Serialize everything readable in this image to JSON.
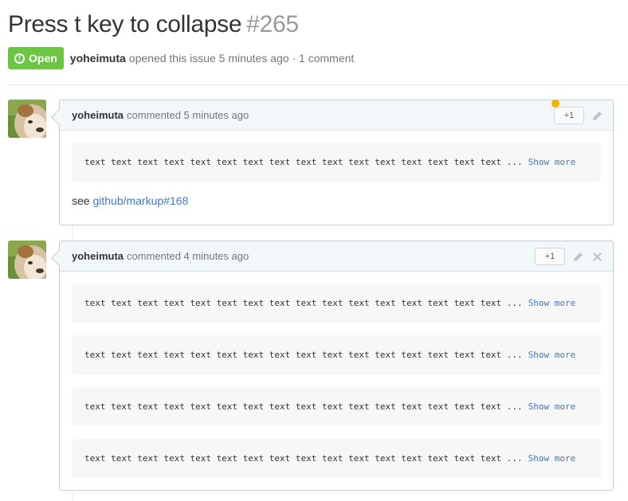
{
  "issue": {
    "title": "Press t key to collapse",
    "number": "#265",
    "state_label": "Open",
    "state_icon": "!",
    "state_color": "#6cc644",
    "author": "yoheimuta",
    "meta_text": "opened this issue 5 minutes ago · 1 comment"
  },
  "comments": [
    {
      "author": "yoheimuta",
      "time_text": "commented 5 minutes ago",
      "plus_one": "+1",
      "code_blocks": [
        {
          "text": "text text text text text text text text text text text text text text text text ...",
          "more": "Show more"
        }
      ],
      "see_label": "see",
      "link_text": "github/markup#168"
    },
    {
      "author": "yoheimuta",
      "time_text": "commented 4 minutes ago",
      "plus_one": "+1",
      "code_blocks": [
        {
          "text": "text text text text text text text text text text text text text text text text ...",
          "more": "Show more"
        },
        {
          "text": "text text text text text text text text text text text text text text text text ...",
          "more": "Show more"
        },
        {
          "text": "text text text text text text text text text text text text text text text text ...",
          "more": "Show more"
        },
        {
          "text": "text text text text text text text text text text text text text text text text ...",
          "more": "Show more"
        }
      ]
    }
  ],
  "colors": {
    "link": "#4078c0",
    "notification_dot": "#f6b200"
  },
  "icons": [
    "alert-icon",
    "pencil-icon",
    "close-icon"
  ]
}
